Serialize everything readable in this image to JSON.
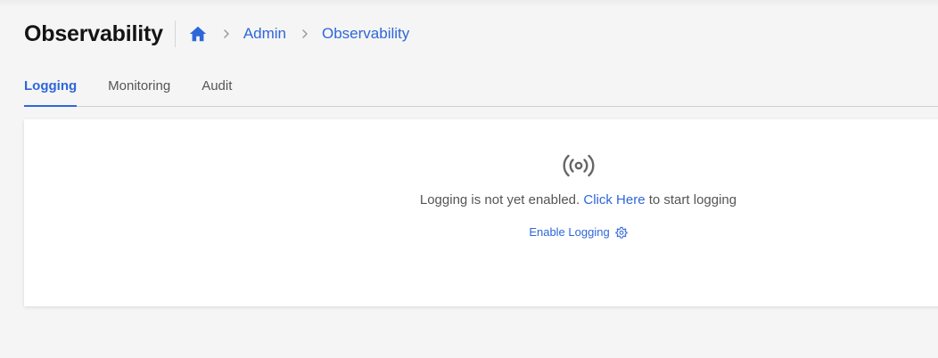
{
  "page": {
    "title": "Observability"
  },
  "breadcrumb": {
    "home_icon": "home-icon",
    "items": [
      "Admin",
      "Observability"
    ]
  },
  "tabs": [
    {
      "label": "Logging",
      "active": true
    },
    {
      "label": "Monitoring",
      "active": false
    },
    {
      "label": "Audit",
      "active": false
    }
  ],
  "empty_state": {
    "icon": "broadcast-icon",
    "message_before": "Logging is not yet enabled. ",
    "message_link": "Click Here",
    "message_after": " to start logging",
    "button_label": "Enable Logging",
    "button_icon": "gear-icon"
  },
  "colors": {
    "accent": "#2e67d9",
    "title": "#141414",
    "muted_text": "#555555",
    "icon_gray": "#666666",
    "background": "#f5f5f5",
    "card": "#ffffff"
  }
}
